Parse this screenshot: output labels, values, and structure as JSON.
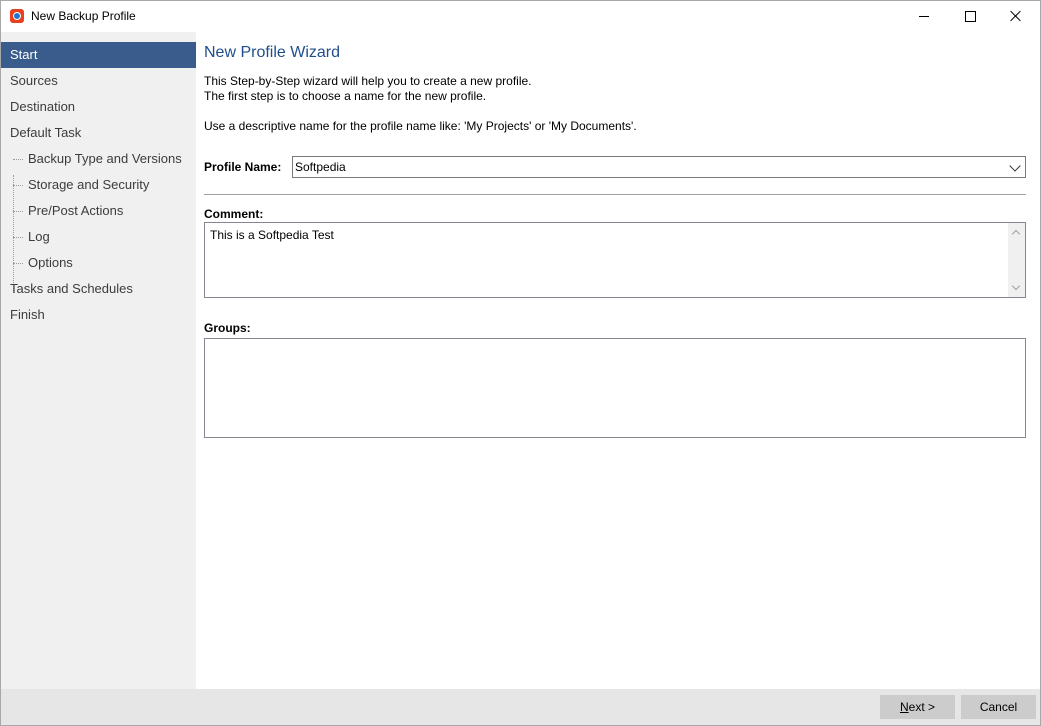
{
  "window": {
    "title": "New Backup Profile"
  },
  "sidebar": {
    "items": [
      {
        "label": "Start",
        "active": true
      },
      {
        "label": "Sources"
      },
      {
        "label": "Destination"
      },
      {
        "label": "Default Task"
      },
      {
        "label": "Backup Type and Versions",
        "sub": true
      },
      {
        "label": "Storage and Security",
        "sub": true
      },
      {
        "label": "Pre/Post Actions",
        "sub": true
      },
      {
        "label": "Log",
        "sub": true
      },
      {
        "label": "Options",
        "sub": true
      },
      {
        "label": "Tasks and Schedules"
      },
      {
        "label": "Finish"
      }
    ]
  },
  "main": {
    "title": "New Profile Wizard",
    "intro_line1": "This Step-by-Step wizard will help you to create a new profile.",
    "intro_line2": "The first step is to choose a name  for the new profile.",
    "intro_line3": "Use a descriptive name for the profile name like: 'My Projects' or 'My Documents'.",
    "profile_name_label": "Profile Name:",
    "profile_name_value": "Softpedia",
    "comment_label": "Comment:",
    "comment_value": "This is a Softpedia Test",
    "groups_label": "Groups:",
    "groups_value": ""
  },
  "footer": {
    "next_mnemonic": "N",
    "next_rest": "ext >",
    "cancel_label": "Cancel"
  },
  "colors": {
    "active_nav": "#3a5c8c",
    "title_blue": "#1f4e8c",
    "sidebar_bg": "#f0f0f0"
  }
}
